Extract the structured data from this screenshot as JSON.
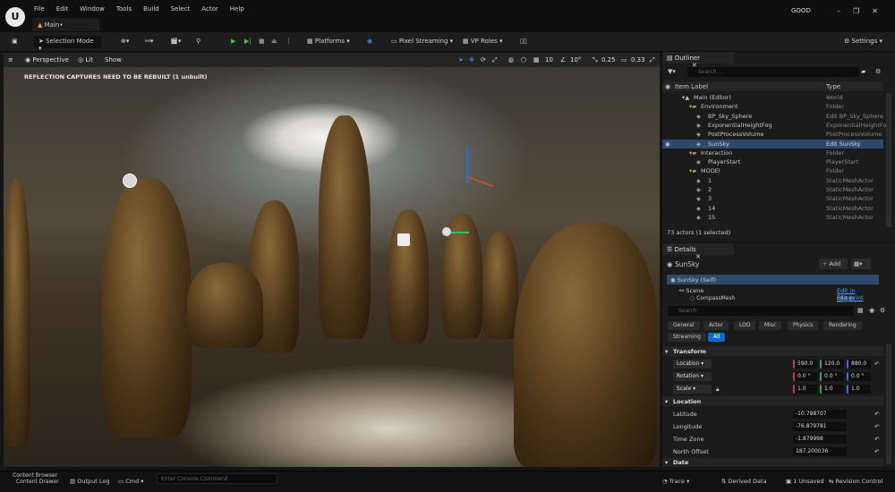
{
  "menu": [
    "File",
    "Edit",
    "Window",
    "Tools",
    "Build",
    "Select",
    "Actor",
    "Help"
  ],
  "tab_title": "Main•",
  "user_badge": "GOOD",
  "toolbar": {
    "mode": "Selection Mode",
    "platforms": "Platforms",
    "pixel_streaming": "Pixel Streaming",
    "vp_roles": "VP Roles",
    "settings": "Settings"
  },
  "viewport": {
    "perspective": "Perspective",
    "lit": "Lit",
    "show": "Show",
    "grid": "10",
    "angle": "10°",
    "scale": "0.25",
    "cam_speed": "0.33",
    "warning": "REFLECTION CAPTURES NEED TO BE REBUILT (1 unbuilt)"
  },
  "outliner": {
    "title": "Outliner",
    "search_placeholder": "Search...",
    "col_label": "Item Label",
    "col_type": "Type",
    "rows": [
      {
        "name": "Main (Editor)",
        "type": "World",
        "indent": 1
      },
      {
        "name": "Environment",
        "type": "Folder",
        "indent": 2
      },
      {
        "name": "BP_Sky_Sphere",
        "type": "Edit BP_Sky_Sphere",
        "indent": 3,
        "link": true
      },
      {
        "name": "ExponentialHeightFog",
        "type": "ExponentialHeightFog",
        "indent": 3
      },
      {
        "name": "PostProcessVolume",
        "type": "PostProcessVolume",
        "indent": 3
      },
      {
        "name": "SunSky",
        "type": "Edit SunSky",
        "indent": 3,
        "selected": true
      },
      {
        "name": "Interaction",
        "type": "Folder",
        "indent": 2
      },
      {
        "name": "PlayerStart",
        "type": "PlayerStart",
        "indent": 3
      },
      {
        "name": "MODEl",
        "type": "Folder",
        "indent": 2
      },
      {
        "name": "1",
        "type": "StaticMeshActor",
        "indent": 3
      },
      {
        "name": "2",
        "type": "StaticMeshActor",
        "indent": 3
      },
      {
        "name": "3",
        "type": "StaticMeshActor",
        "indent": 3
      },
      {
        "name": "14",
        "type": "StaticMeshActor",
        "indent": 3
      },
      {
        "name": "15",
        "type": "StaticMeshActor",
        "indent": 3
      }
    ],
    "footer": "73 actors (1 selected)"
  },
  "details": {
    "title": "Details",
    "actor": "SunSky",
    "add": "Add",
    "self_row": "SunSky (Self)",
    "scene": "Scene",
    "component": "CompassMesh",
    "edit_blueprint": "Edit in Blueprint",
    "search_placeholder": "Search",
    "categories": [
      "General",
      "Actor",
      "LOD",
      "Misc",
      "Physics",
      "Rendering",
      "Streaming",
      "All"
    ],
    "transform": "Transform",
    "location_label": "Location",
    "rotation_label": "Rotation",
    "scale_label": "Scale",
    "location": [
      "590.0",
      "120.0",
      "880.0"
    ],
    "rotation": [
      "0.0 °",
      "0.0 °",
      "0.0 °"
    ],
    "scale": [
      "1.0",
      "1.0",
      "1.0"
    ],
    "location_section": "Location",
    "latitude_label": "Latitude",
    "latitude": "-10.798707",
    "longitude_label": "Longitude",
    "longitude": "-76.879781",
    "timezone_label": "Time Zone",
    "timezone": "-1.879998",
    "north_label": "North Offset",
    "north": "187.200036",
    "date_section": "Date"
  },
  "status": {
    "content_browser": "Content Browser",
    "content_drawer": "Content Drawer",
    "output_log": "Output Log",
    "cmd": "Cmd",
    "console_placeholder": "Enter Console Command",
    "trace": "Trace",
    "derived": "Derived Data",
    "unsaved": "1 Unsaved",
    "revision": "Revision Control"
  }
}
